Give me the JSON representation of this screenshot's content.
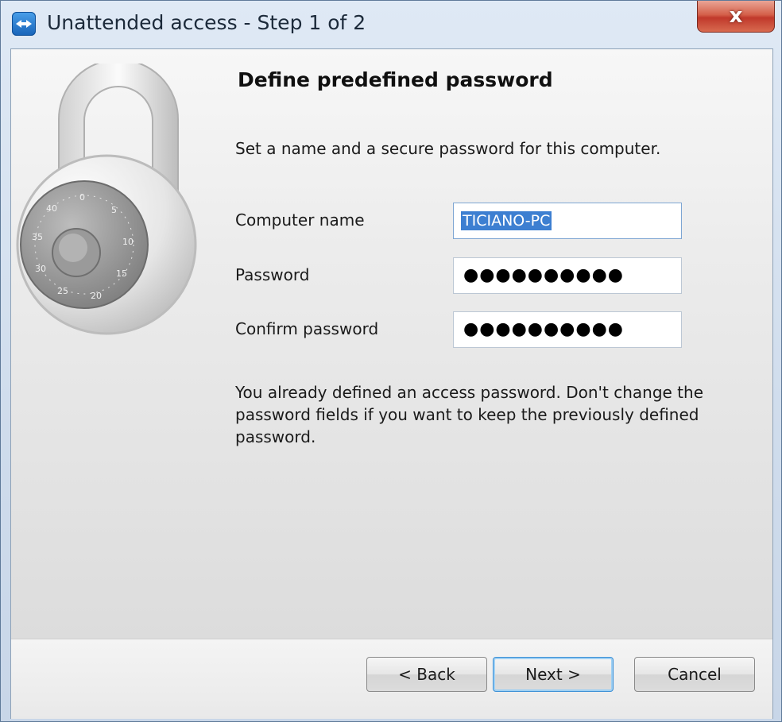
{
  "window": {
    "title": "Unattended access - Step 1 of 2",
    "close_label": "x"
  },
  "content": {
    "heading": "Define predefined password",
    "description": "Set a name and a secure password for this computer.",
    "fields": [
      {
        "label": "Computer name",
        "value": "TICIANO-PC",
        "selected": true
      },
      {
        "label": "Password",
        "value": "●●●●●●●●●●",
        "masked": true
      },
      {
        "label": "Confirm password",
        "value": "●●●●●●●●●●",
        "masked": true
      }
    ],
    "note": "You already defined an access password. Don't change the password fields if you want to keep the previously defined password."
  },
  "buttons": {
    "back": "< Back",
    "next": "Next >",
    "cancel": "Cancel"
  },
  "colors": {
    "selection": "#3d7fd1",
    "default_button_border": "#3a8fd6",
    "close_button": "#c0392b"
  },
  "icons": [
    "teamviewer-app-icon",
    "close-icon",
    "padlock-icon"
  ]
}
